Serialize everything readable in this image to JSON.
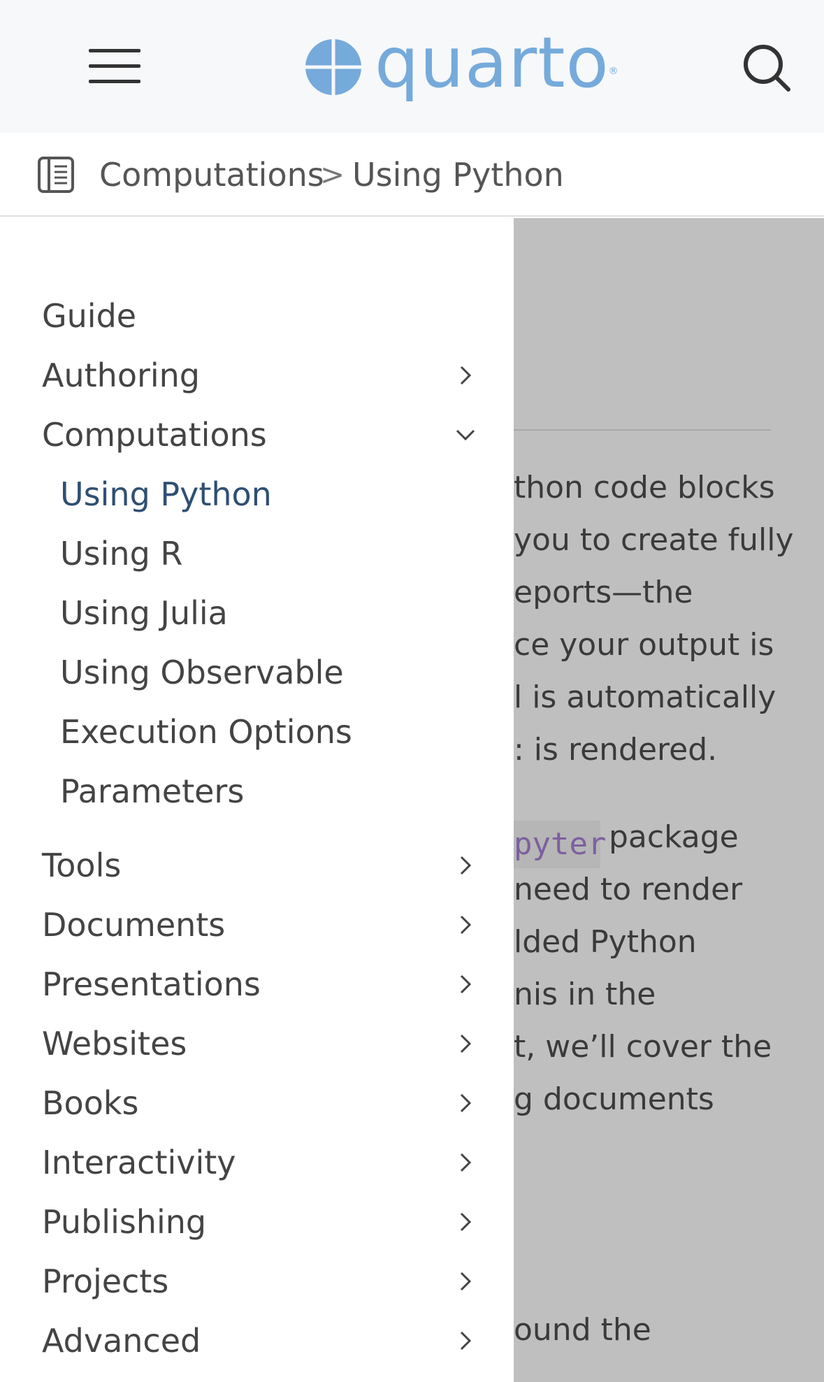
{
  "header": {
    "menu_icon": "hamburger-icon",
    "logo_text": "quarto",
    "logo_mark": "®",
    "search_icon": "search-icon",
    "colors": {
      "logo_blue": "#75aadb",
      "bar_bg": "#f7f8f9"
    }
  },
  "breadcrumb": {
    "toc_icon": "toc-book-icon",
    "section": "Computations",
    "separator": ">",
    "page": "Using Python"
  },
  "sidebar": {
    "items": [
      {
        "label": "Guide",
        "chevron": null
      },
      {
        "label": "Authoring",
        "chevron": "right"
      },
      {
        "label": "Computations",
        "chevron": "down"
      },
      {
        "label": "Using Python",
        "sub": true,
        "active": true
      },
      {
        "label": "Using R",
        "sub": true
      },
      {
        "label": "Using Julia",
        "sub": true
      },
      {
        "label": "Using Observable",
        "sub": true
      },
      {
        "label": "Execution Options",
        "sub": true
      },
      {
        "label": "Parameters",
        "sub": true
      },
      {
        "label": "Tools",
        "chevron": "right"
      },
      {
        "label": "Documents",
        "chevron": "right"
      },
      {
        "label": "Presentations",
        "chevron": "right"
      },
      {
        "label": "Websites",
        "chevron": "right"
      },
      {
        "label": "Books",
        "chevron": "right"
      },
      {
        "label": "Interactivity",
        "chevron": "right"
      },
      {
        "label": "Publishing",
        "chevron": "right"
      },
      {
        "label": "Projects",
        "chevron": "right"
      },
      {
        "label": "Advanced",
        "chevron": "right"
      }
    ],
    "colors": {
      "text": "#444444",
      "active": "#2f4f73"
    }
  },
  "underlying": {
    "lines": [
      "thon code blocks",
      "you to create fully",
      "eports—the",
      "ce your output is",
      "l is automatically",
      ": is rendered.",
      "package",
      "need to render",
      "lded Python",
      "nis in the",
      "t, we’ll cover the",
      "g documents",
      "ound the"
    ],
    "code_fragment": "pyter",
    "overlay_color": "#bfbfbf"
  }
}
